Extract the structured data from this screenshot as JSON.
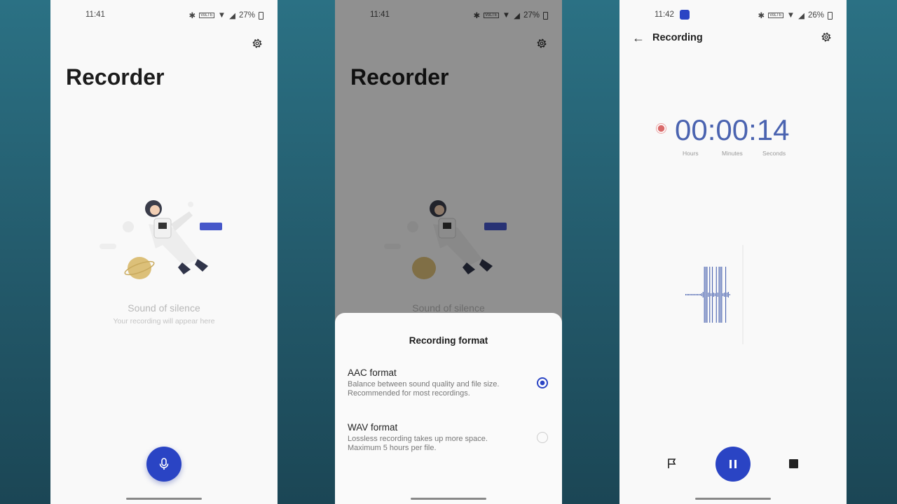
{
  "screens": [
    {
      "status": {
        "time": "11:41",
        "battery": "27%"
      },
      "title": "Recorder",
      "empty_title": "Sound of silence",
      "empty_subtitle": "Your recording will appear here"
    },
    {
      "status": {
        "time": "11:41",
        "battery": "27%"
      },
      "title": "Recorder",
      "empty_title": "Sound of silence",
      "sheet": {
        "title": "Recording format",
        "options": [
          {
            "name": "AAC format",
            "desc": "Balance between sound quality and file size. Recommended for most recordings.",
            "selected": true
          },
          {
            "name": "WAV format",
            "desc": "Lossless recording takes up more space. Maximum 5 hours per file.",
            "selected": false
          }
        ]
      }
    },
    {
      "status": {
        "time": "11:42",
        "battery": "26%"
      },
      "title": "Recording",
      "timer": {
        "hours": "00",
        "minutes": "00",
        "seconds": "14",
        "sep": ":",
        "labels": [
          "Hours",
          "Minutes",
          "Seconds"
        ]
      }
    }
  ],
  "colors": {
    "accent": "#2a44c4",
    "timer": "#4a63b0",
    "record": "#d96a6a"
  }
}
